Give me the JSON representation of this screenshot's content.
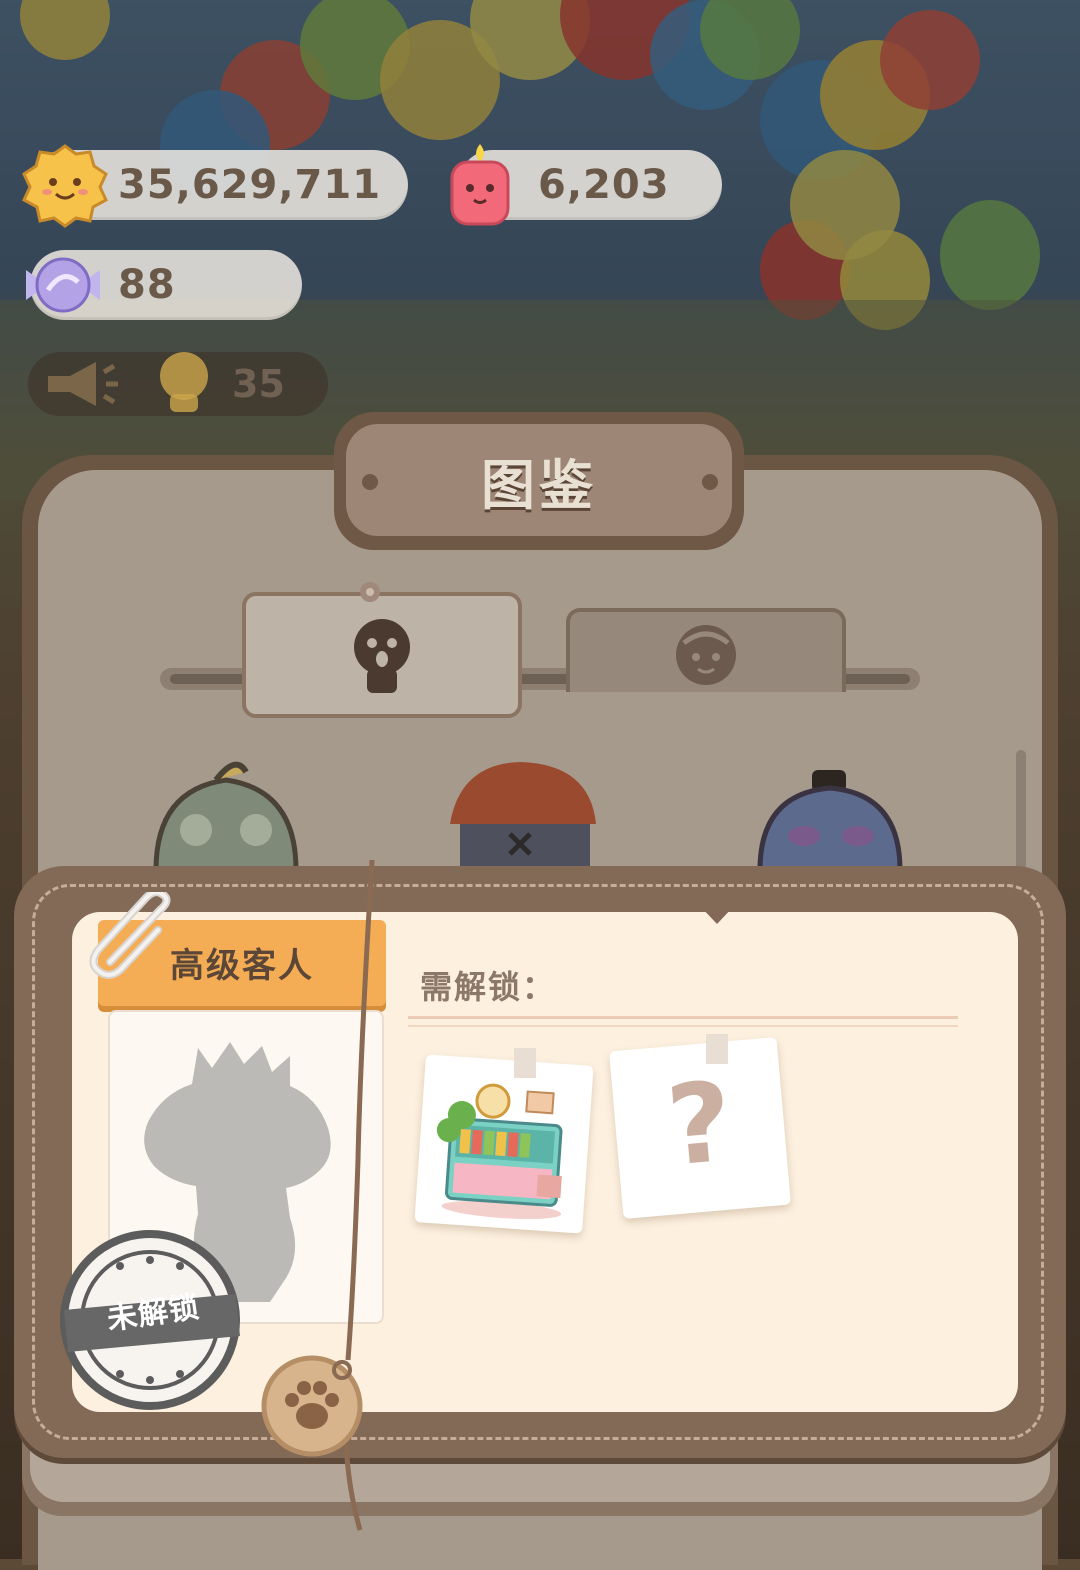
{
  "resources": {
    "cookies": "35,629,711",
    "candles": "6,203",
    "candy": "88",
    "notice_count": "35"
  },
  "panel": {
    "title": "图鉴",
    "tabs": [
      {
        "icon": "customer-silhouette-icon",
        "active": true
      },
      {
        "icon": "chef-face-icon",
        "active": false
      }
    ]
  },
  "detail": {
    "category": "高级客人",
    "unlock_label": "需解锁：",
    "status_stamp": "未解锁",
    "requirements": [
      {
        "icon": "shop-shelf-icon"
      },
      {
        "icon": "question-mark-icon",
        "text": "?"
      }
    ]
  },
  "colors": {
    "accent_orange": "#f4ad55",
    "leather": "#826a57",
    "paper": "#fdf0df"
  }
}
